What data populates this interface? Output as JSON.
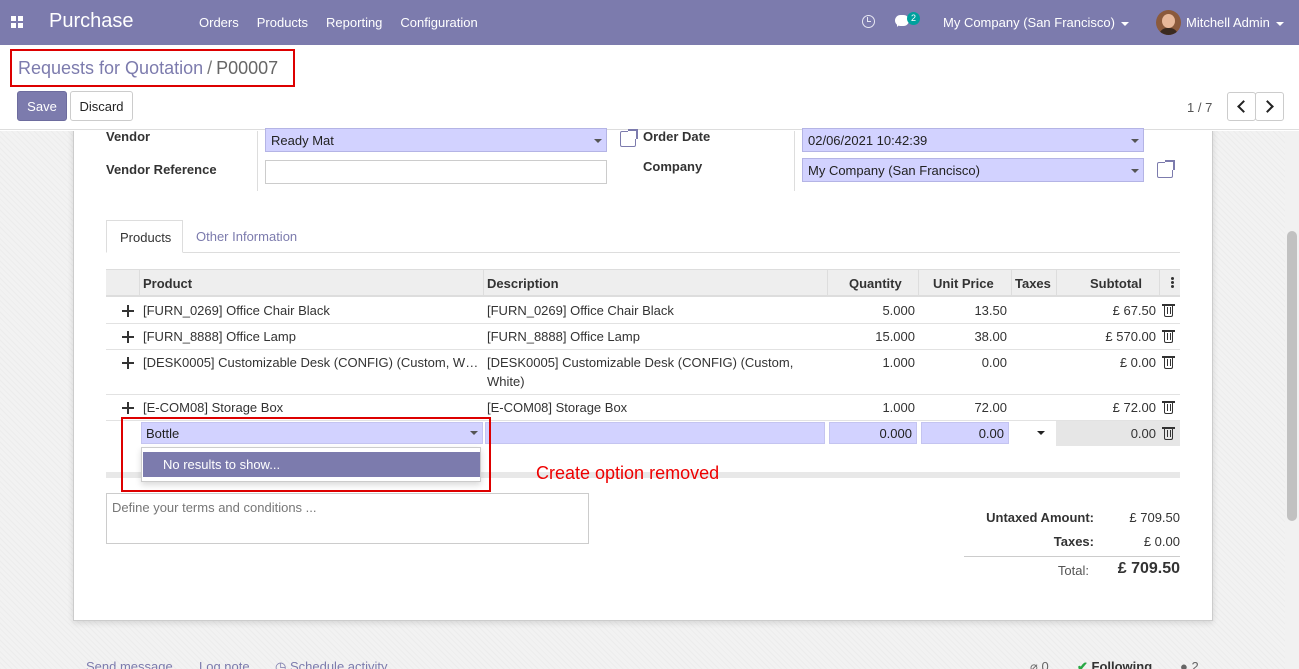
{
  "navbar": {
    "app_name": "Purchase",
    "menu": [
      "Orders",
      "Products",
      "Reporting",
      "Configuration"
    ],
    "chat_count": "2",
    "company": "My Company (San Francisco)",
    "user": "Mitchell Admin"
  },
  "breadcrumb": {
    "parent": "Requests for Quotation",
    "separator": "/",
    "current": "P00007"
  },
  "buttons": {
    "save": "Save",
    "discard": "Discard"
  },
  "pager": {
    "value": "1 / 7"
  },
  "form": {
    "vendor_label": "Vendor",
    "vendor_value": "Ready Mat",
    "vendor_ref_label": "Vendor Reference",
    "vendor_ref_value": "",
    "order_date_label": "Order Date",
    "order_date_value": "02/06/2021 10:42:39",
    "company_label": "Company",
    "company_value": "My Company (San Francisco)"
  },
  "tabs": [
    "Products",
    "Other Information"
  ],
  "table": {
    "headers": {
      "product": "Product",
      "description": "Description",
      "quantity": "Quantity",
      "unit_price": "Unit Price",
      "taxes": "Taxes",
      "subtotal": "Subtotal"
    },
    "rows": [
      {
        "product": "[FURN_0269] Office Chair Black",
        "description": "[FURN_0269] Office Chair Black",
        "description2": "",
        "quantity": "5.000",
        "unit_price": "13.50",
        "taxes": "",
        "subtotal": "£ 67.50"
      },
      {
        "product": "[FURN_8888] Office Lamp",
        "description": "[FURN_8888] Office Lamp",
        "description2": "",
        "quantity": "15.000",
        "unit_price": "38.00",
        "taxes": "",
        "subtotal": "£ 570.00"
      },
      {
        "product": "[DESK0005] Customizable Desk (CONFIG) (Custom, W…",
        "description": "[DESK0005] Customizable Desk (CONFIG) (Custom,",
        "description2": "White)",
        "quantity": "1.000",
        "unit_price": "0.00",
        "taxes": "",
        "subtotal": "£ 0.00"
      },
      {
        "product": "[E-COM08] Storage Box",
        "description": "[E-COM08] Storage Box",
        "description2": "",
        "quantity": "1.000",
        "unit_price": "72.00",
        "taxes": "",
        "subtotal": "£ 72.00"
      }
    ],
    "edit_row": {
      "product": "Bottle",
      "description": "",
      "quantity": "0.000",
      "unit_price": "0.00",
      "subtotal": "0.00"
    }
  },
  "dropdown": {
    "item": "No results to show..."
  },
  "annotation": "Create option removed",
  "terms_placeholder": "Define your terms and conditions ...",
  "totals": {
    "untaxed_label": "Untaxed Amount:",
    "untaxed_value": "£ 709.50",
    "taxes_label": "Taxes:",
    "taxes_value": "£ 0.00",
    "total_label": "Total:",
    "total_value": "£ 709.50"
  },
  "chatter": {
    "send_message": "Send message",
    "log_note": "Log note",
    "schedule_activity": "Schedule activity",
    "attachments": "0",
    "following": "Following",
    "followers": "2"
  }
}
